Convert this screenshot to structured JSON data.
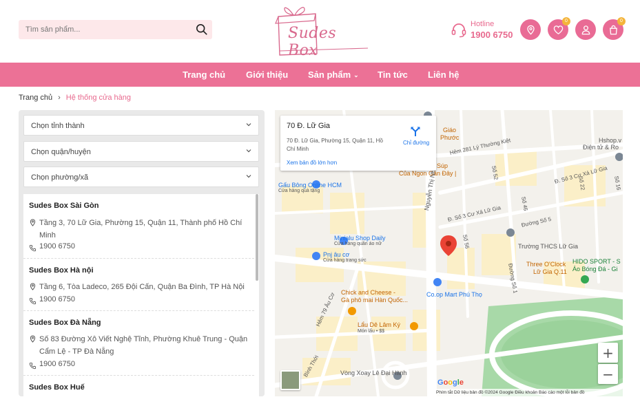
{
  "search": {
    "placeholder": "Tìm sản phẩm..."
  },
  "brand": {
    "logo_text": "Sudes Box"
  },
  "hotline": {
    "label": "Hotline",
    "number": "1900 6750"
  },
  "header_actions": {
    "wishlist_count": "0",
    "cart_count": "0"
  },
  "nav": {
    "items": [
      {
        "label": "Trang chủ"
      },
      {
        "label": "Giới thiệu"
      },
      {
        "label": "Sản phẩm"
      },
      {
        "label": "Tin tức"
      },
      {
        "label": "Liên hệ"
      }
    ]
  },
  "breadcrumb": {
    "home": "Trang chủ",
    "current": "Hệ thống cửa hàng"
  },
  "filters": {
    "province": "Chọn tỉnh thành",
    "district": "Chọn quận/huyện",
    "ward": "Chọn phường/xã"
  },
  "stores": [
    {
      "name": "Sudes Box Sài Gòn",
      "address": "Tầng 3, 70 Lữ Gia, Phường 15, Quận 11, Thành phố Hồ Chí Minh",
      "phone": "1900 6750"
    },
    {
      "name": "Sudes Box Hà nội",
      "address": "Tầng 6, Tòa Ladeco, 265 Đội Cấn, Quận Ba Đình, TP Hà Nội",
      "phone": "1900 6750"
    },
    {
      "name": "Sudes Box Đà Nẵng",
      "address": "Số 83 Đường Xô Viết Nghệ Tĩnh, Phường Khuê Trung - Quận Cẩm Lệ - TP Đà Nẵng",
      "phone": "1900 6750"
    },
    {
      "name": "Sudes Box Huế",
      "address": "",
      "phone": ""
    }
  ],
  "map": {
    "card_title": "70 Đ. Lữ Gia",
    "card_address": "70 Đ. Lữ Gia, Phường 15, Quận 11, Hồ Chí Minh",
    "directions": "Chỉ đường",
    "view_larger": "Xem bản đồ lớn hơn",
    "zoom_in": "+",
    "zoom_out": "−",
    "google": "Google",
    "footer": "Phím tắt    Dữ liệu bản đồ ©2024 Google    Điều khoản    Báo cáo một lỗi bản đồ",
    "labels": {
      "gau_bong": "Gấu Bông Online HCM",
      "gau_bong_sub": "Cửa hàng quà tặng",
      "minialu": "Minialu Shop Daily",
      "minialu_sub": "Cửa hàng quần áo nữ",
      "pnj": "Pnj âu cơ",
      "pnj_sub": "Cửa hàng trang sức",
      "chick": "Chick and Cheese -",
      "chick_2": "Gà phô mai Hàn Quốc...",
      "coop": "Co.op Mart Phú Thọ",
      "lau": "Lẩu Dê Lâm Ký",
      "lau_sub": "Món lẩu • $$",
      "ngon": "Của Ngon Gần Đây |",
      "sup": "Súp",
      "giao": "Giáo",
      "phuoc": "Phước",
      "thcs": "Trường THCS Lữ Gia",
      "three": "Three O'Clock",
      "three_2": "Lữ Gia Q.11",
      "hido": "HIDO SPORT - S",
      "hido_2": "Áo Bóng Đá - Gi",
      "hshop": "Hshop.v",
      "hshop_2": "Điện tử & Ro",
      "vong_xoay": "Vòng Xoay Lê Đại Hành",
      "nguyen_thi_nho": "Nguyễn Thị Nhỏ",
      "hem_281": "Hẻm 281 Lý Thường Kiệt",
      "duong_so3": "Đ. Số 3 Cư Xá Lữ Gia",
      "duong_so3b": "Đ. Số 3 Cư Xá Lữ Gia",
      "duong_so5": "Đường Số 5",
      "hem79": "Hẻm 79 Âu Cơ",
      "binh_thoi": "Bình Thới",
      "so52": "Số 52",
      "so46": "Số 46",
      "so56": "Số 56",
      "so16": "Số 16",
      "so22": "Số 22",
      "duong_so1": "Đường Số 1"
    }
  }
}
